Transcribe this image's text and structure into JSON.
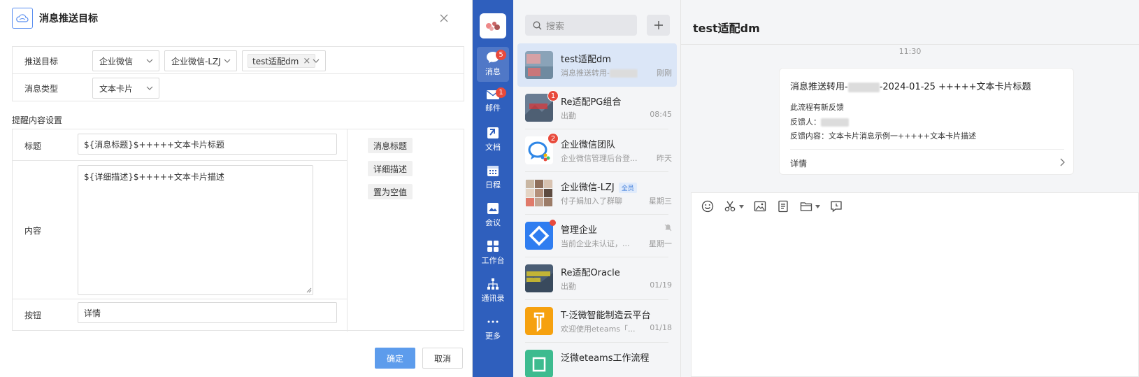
{
  "dialog": {
    "title": "消息推送目标",
    "push_target_label": "推送目标",
    "push_target_1": "企业微信",
    "push_target_2": "企业微信-LZJ",
    "push_target_tag": "test适配dm",
    "message_type_label": "消息类型",
    "message_type_value": "文本卡片",
    "reminder_section": "提醒内容设置",
    "title_field_label": "标题",
    "title_field_value": "${消息标题}$+++++文本卡片标题",
    "content_field_label": "内容",
    "content_field_value": "${详细描述}$+++++文本卡片描述",
    "button_field_label": "按钮",
    "button_field_value": "详情",
    "chips": [
      "消息标题",
      "详细描述",
      "置为空值"
    ],
    "ok_label": "确定",
    "cancel_label": "取消"
  },
  "nav": {
    "items": [
      {
        "label": "消息",
        "badge": "5",
        "icon": "chat-icon"
      },
      {
        "label": "邮件",
        "badge": "1",
        "icon": "mail-icon"
      },
      {
        "label": "文档",
        "badge": "",
        "icon": "doc-icon"
      },
      {
        "label": "日程",
        "badge": "",
        "icon": "calendar-icon"
      },
      {
        "label": "会议",
        "badge": "",
        "icon": "meeting-icon"
      },
      {
        "label": "工作台",
        "badge": "",
        "icon": "grid-icon"
      },
      {
        "label": "通讯录",
        "badge": "",
        "icon": "org-icon"
      },
      {
        "label": "更多",
        "badge": "",
        "icon": "more-icon"
      }
    ]
  },
  "chat_list": {
    "search_placeholder": "搜索",
    "chats": [
      {
        "name": "test适配dm",
        "preview": "消息推送转用-",
        "time": "刚刚",
        "badge": ""
      },
      {
        "name": "Re适配PG组合",
        "preview": "出勤",
        "time": "08:45",
        "badge": "1"
      },
      {
        "name": "企业微信团队",
        "preview": "企业微信管理后台登...",
        "time": "昨天",
        "badge": "2"
      },
      {
        "name": "企业微信-LZJ",
        "preview": "付子娟加入了群聊",
        "time": "星期三",
        "badge": "",
        "tag": "全员"
      },
      {
        "name": "管理企业",
        "preview": "当前企业未认证，...",
        "time": "星期一",
        "badge": ""
      },
      {
        "name": "Re适配Oracle",
        "preview": "出勤",
        "time": "01/19",
        "badge": ""
      },
      {
        "name": "T-泛微智能制造云平台",
        "preview": "欢迎使用eteams「...",
        "time": "01/18",
        "badge": ""
      },
      {
        "name": "泛微eteams工作流程",
        "preview": "",
        "time": "",
        "badge": ""
      }
    ]
  },
  "conversation": {
    "title": "test适配dm",
    "time": "11:30",
    "card": {
      "title_prefix": "消息推送转用-",
      "title_suffix": "-2024-01-25 +++++文本卡片标题",
      "line1": "此流程有新反馈",
      "line2": "反馈人：",
      "line3": "反馈内容：文本卡片消息示例一+++++文本卡片描述",
      "detail": "详情"
    }
  }
}
